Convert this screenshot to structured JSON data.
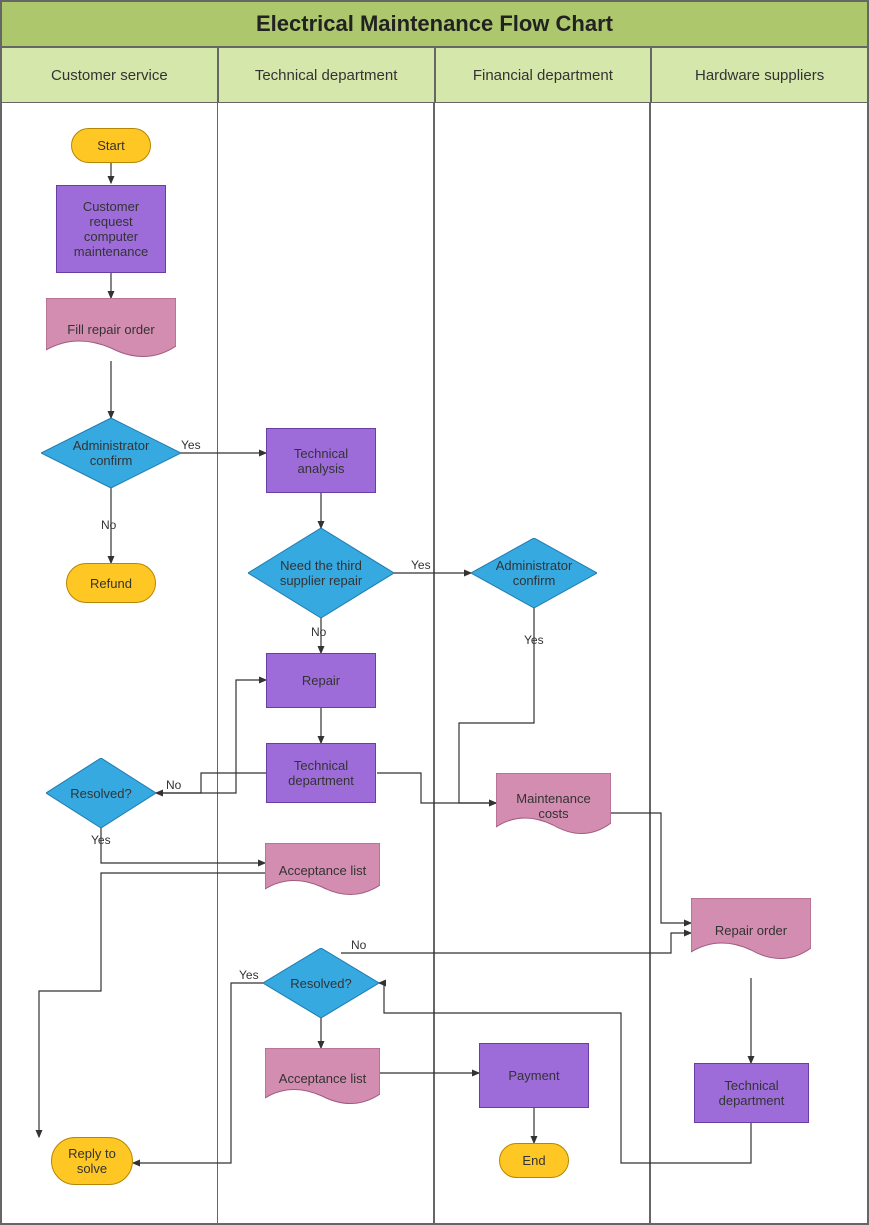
{
  "title": "Electrical Maintenance Flow Chart",
  "lanes": [
    "Customer service",
    "Technical department",
    "Financial department",
    "Hardware suppliers"
  ],
  "nodes": {
    "start": "Start",
    "request": "Customer request computer maintenance",
    "fill_order": "Fill repair order",
    "admin_confirm1": "Administrator confirm",
    "refund": "Refund",
    "tech_analysis": "Technical analysis",
    "need_third": "Need the third supplier repair",
    "admin_confirm2": "Administrator confirm",
    "repair": "Repair",
    "tech_dept1": "Technical department",
    "maint_costs": "Maintenance costs",
    "resolved1": "Resolved?",
    "acc_list1": "Acceptance list",
    "repair_order2": "Repair order",
    "tech_dept2": "Technical department",
    "resolved2": "Resolved?",
    "acc_list2": "Acceptance list",
    "payment": "Payment",
    "reply_solve": "Reply to solve",
    "end": "End"
  },
  "labels": {
    "yes": "Yes",
    "no": "No"
  },
  "chart_data": {
    "type": "flowchart",
    "title": "Electrical Maintenance Flow Chart",
    "swimlanes": [
      "Customer service",
      "Technical department",
      "Financial department",
      "Hardware suppliers"
    ],
    "nodes": [
      {
        "id": "start",
        "lane": "Customer service",
        "type": "terminator",
        "label": "Start"
      },
      {
        "id": "request",
        "lane": "Customer service",
        "type": "process",
        "label": "Customer request computer maintenance"
      },
      {
        "id": "fill_order",
        "lane": "Customer service",
        "type": "document",
        "label": "Fill repair order"
      },
      {
        "id": "admin_confirm1",
        "lane": "Customer service",
        "type": "decision",
        "label": "Administrator confirm"
      },
      {
        "id": "refund",
        "lane": "Customer service",
        "type": "terminator",
        "label": "Refund"
      },
      {
        "id": "resolved1",
        "lane": "Customer service",
        "type": "decision",
        "label": "Resolved?"
      },
      {
        "id": "reply_solve",
        "lane": "Customer service",
        "type": "terminator",
        "label": "Reply to solve"
      },
      {
        "id": "tech_analysis",
        "lane": "Technical department",
        "type": "process",
        "label": "Technical analysis"
      },
      {
        "id": "need_third",
        "lane": "Technical department",
        "type": "decision",
        "label": "Need the third supplier repair"
      },
      {
        "id": "repair",
        "lane": "Technical department",
        "type": "process",
        "label": "Repair"
      },
      {
        "id": "tech_dept1",
        "lane": "Technical department",
        "type": "process",
        "label": "Technical department"
      },
      {
        "id": "acc_list1",
        "lane": "Technical department",
        "type": "document",
        "label": "Acceptance list"
      },
      {
        "id": "resolved2",
        "lane": "Technical department",
        "type": "decision",
        "label": "Resolved?"
      },
      {
        "id": "acc_list2",
        "lane": "Technical department",
        "type": "document",
        "label": "Acceptance list"
      },
      {
        "id": "admin_confirm2",
        "lane": "Financial department",
        "type": "decision",
        "label": "Administrator confirm"
      },
      {
        "id": "maint_costs",
        "lane": "Financial department",
        "type": "document",
        "label": "Maintenance costs"
      },
      {
        "id": "payment",
        "lane": "Financial department",
        "type": "process",
        "label": "Payment"
      },
      {
        "id": "end",
        "lane": "Financial department",
        "type": "terminator",
        "label": "End"
      },
      {
        "id": "repair_order2",
        "lane": "Hardware suppliers",
        "type": "document",
        "label": "Repair order"
      },
      {
        "id": "tech_dept2",
        "lane": "Hardware suppliers",
        "type": "process",
        "label": "Technical department"
      }
    ],
    "edges": [
      {
        "from": "start",
        "to": "request"
      },
      {
        "from": "request",
        "to": "fill_order"
      },
      {
        "from": "fill_order",
        "to": "admin_confirm1"
      },
      {
        "from": "admin_confirm1",
        "to": "refund",
        "label": "No"
      },
      {
        "from": "admin_confirm1",
        "to": "tech_analysis",
        "label": "Yes"
      },
      {
        "from": "tech_analysis",
        "to": "need_third"
      },
      {
        "from": "need_third",
        "to": "repair",
        "label": "No"
      },
      {
        "from": "need_third",
        "to": "admin_confirm2",
        "label": "Yes"
      },
      {
        "from": "admin_confirm2",
        "to": "maint_costs",
        "label": "Yes"
      },
      {
        "from": "maint_costs",
        "to": "repair_order2"
      },
      {
        "from": "repair_order2",
        "to": "tech_dept2"
      },
      {
        "from": "tech_dept2",
        "to": "resolved2"
      },
      {
        "from": "repair",
        "to": "tech_dept1"
      },
      {
        "from": "tech_dept1",
        "to": "resolved1"
      },
      {
        "from": "resolved1",
        "to": "repair",
        "label": "No"
      },
      {
        "from": "resolved1",
        "to": "acc_list1",
        "label": "Yes"
      },
      {
        "from": "acc_list1",
        "to": "reply_solve"
      },
      {
        "from": "resolved2",
        "to": "reply_solve",
        "label": "Yes"
      },
      {
        "from": "resolved2",
        "to": "repair_order2",
        "label": "No"
      },
      {
        "from": "resolved2",
        "to": "acc_list2"
      },
      {
        "from": "acc_list2",
        "to": "payment"
      },
      {
        "from": "payment",
        "to": "end"
      }
    ]
  }
}
